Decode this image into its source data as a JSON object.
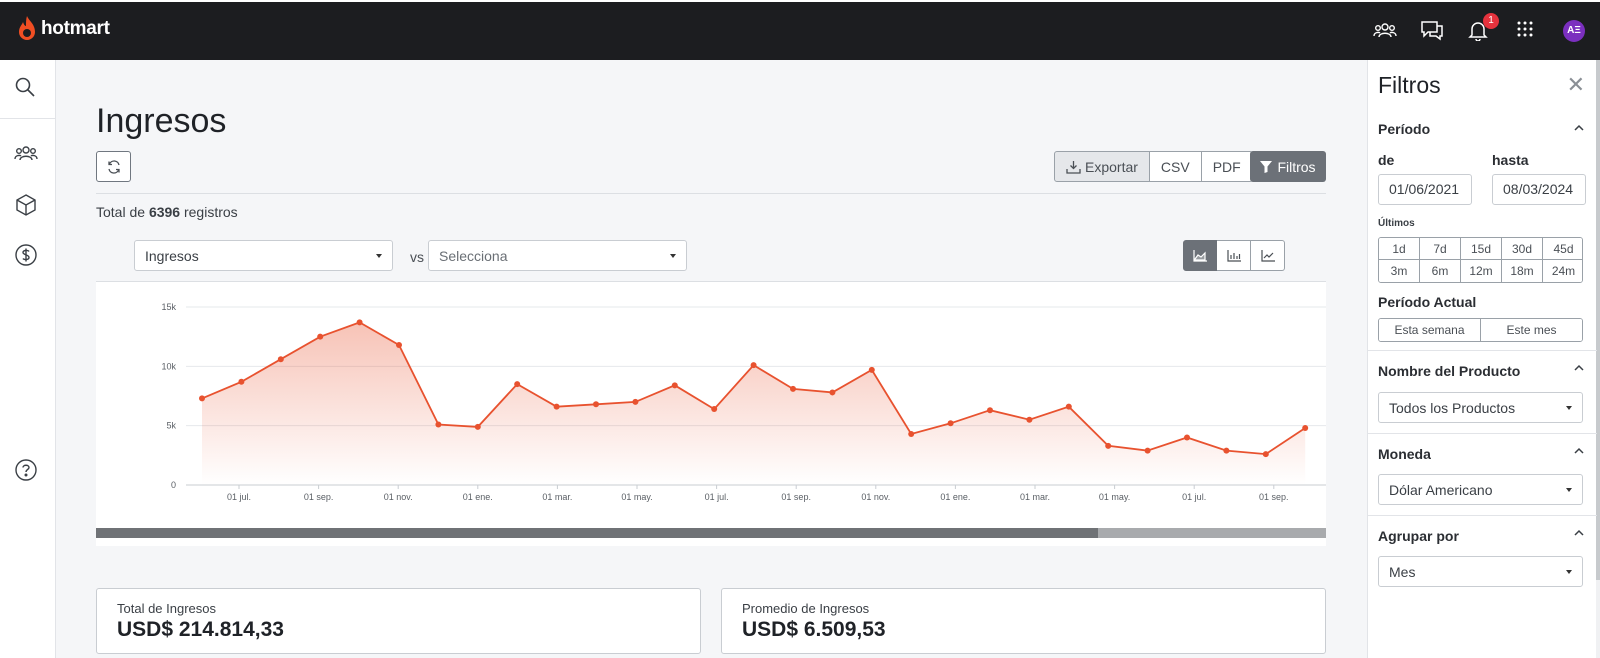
{
  "brand": {
    "name": "hotmart",
    "accent": "#f04e23"
  },
  "topbar": {
    "icons": [
      "community-icon",
      "chat-icon",
      "bell-icon",
      "apps-grid-icon"
    ],
    "notification_count": "1",
    "avatar_initials": "AΞ"
  },
  "leftnav": {
    "icons": [
      "search-icon",
      "users-icon",
      "box-icon",
      "dollar-icon",
      "help-icon"
    ]
  },
  "main": {
    "title": "Ingresos",
    "export_label": "Exportar",
    "csv_label": "CSV",
    "pdf_label": "PDF",
    "filters_label": "Filtros",
    "total_prefix": "Total de",
    "total_count": "6396",
    "total_suffix": "registros",
    "metric_select": "Ingresos",
    "vs_label": "vs",
    "compare_select_placeholder": "Selecciona",
    "chart_type_active": "area",
    "cards": [
      {
        "label": "Total de Ingresos",
        "value": "USD$ 214.814,33"
      },
      {
        "label": "Promedio de Ingresos",
        "value": "USD$ 6.509,53"
      }
    ]
  },
  "chart_data": {
    "type": "area",
    "series_color": "#e8522f",
    "yticks": [
      "15k",
      "10k",
      "5k",
      "0"
    ],
    "ylim": [
      0,
      15000
    ],
    "xtick_labels": [
      "01 jul.",
      "01 sep.",
      "01 nov.",
      "01 ene.",
      "01 mar.",
      "01 may.",
      "01 jul.",
      "01 sep.",
      "01 nov.",
      "01 ene.",
      "01 mar.",
      "01 may.",
      "01 jul.",
      "01 sep."
    ],
    "x": [
      "2021-06",
      "2021-07",
      "2021-08",
      "2021-09",
      "2021-10",
      "2021-11",
      "2021-12",
      "2022-01",
      "2022-02",
      "2022-03",
      "2022-04",
      "2022-05",
      "2022-06",
      "2022-07",
      "2022-08",
      "2022-09",
      "2022-10",
      "2022-11",
      "2022-12",
      "2023-01",
      "2023-02",
      "2023-03",
      "2023-04",
      "2023-05",
      "2023-06",
      "2023-07",
      "2023-08",
      "2023-09",
      "2023-10",
      "2023-11",
      "2023-12"
    ],
    "values": [
      7300,
      8700,
      10600,
      12500,
      13700,
      11800,
      5100,
      4900,
      8500,
      6600,
      6800,
      7000,
      8400,
      6400,
      10100,
      8100,
      7800,
      9700,
      4300,
      5200,
      6300,
      5500,
      6600,
      3300,
      2900,
      4000,
      2900,
      2600,
      4800
    ],
    "grid": true,
    "legend": "none"
  },
  "filters": {
    "title": "Filtros",
    "periodo_title": "Período",
    "de_label": "de",
    "hasta_label": "hasta",
    "de_value": "01/06/2021",
    "hasta_value": "08/03/2024",
    "ultimos_label": "Últimos",
    "ultimos_options": [
      "1d",
      "7d",
      "15d",
      "30d",
      "45d",
      "3m",
      "6m",
      "12m",
      "18m",
      "24m"
    ],
    "actual_title": "Período Actual",
    "actual_options": [
      "Esta semana",
      "Este mes"
    ],
    "producto_title": "Nombre del Producto",
    "producto_value": "Todos los Productos",
    "moneda_title": "Moneda",
    "moneda_value": "Dólar Americano",
    "agrupar_title": "Agrupar por",
    "agrupar_value": "Mes"
  }
}
